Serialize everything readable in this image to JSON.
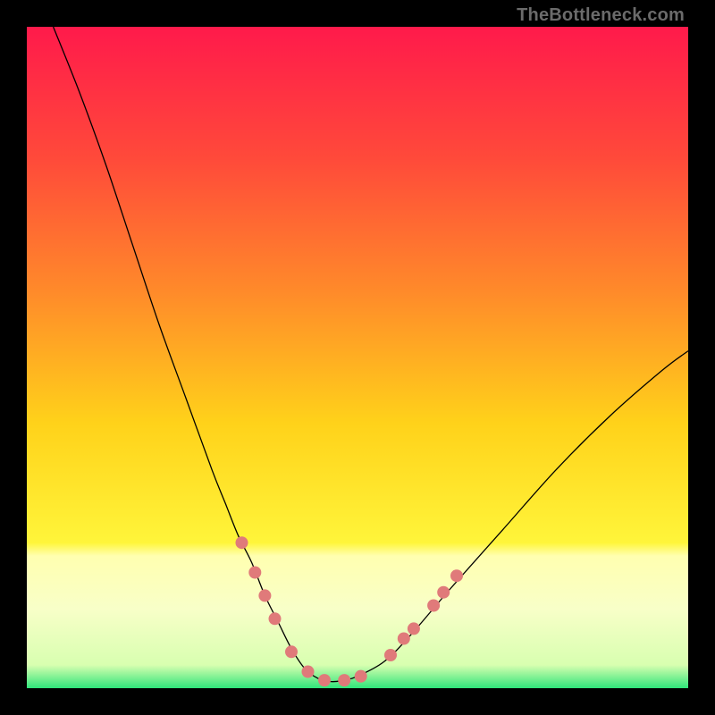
{
  "watermark": "TheBottleneck.com",
  "chart_data": {
    "type": "line",
    "title": "",
    "xlabel": "",
    "ylabel": "",
    "xlim": [
      0,
      100
    ],
    "ylim": [
      0,
      100
    ],
    "grid": false,
    "legend": false,
    "background_gradient": {
      "stops": [
        {
          "pos": 0.0,
          "color": "#ff1a4b"
        },
        {
          "pos": 0.2,
          "color": "#ff4a3a"
        },
        {
          "pos": 0.4,
          "color": "#ff8a2a"
        },
        {
          "pos": 0.6,
          "color": "#ffd21a"
        },
        {
          "pos": 0.78,
          "color": "#fff53a"
        },
        {
          "pos": 0.8,
          "color": "#ffffb0"
        },
        {
          "pos": 0.88,
          "color": "#f8ffc8"
        },
        {
          "pos": 0.965,
          "color": "#d8ffb0"
        },
        {
          "pos": 1.0,
          "color": "#2fe57a"
        }
      ]
    },
    "series": [
      {
        "name": "bottleneck-curve",
        "stroke": "#000000",
        "stroke_width": 1.3,
        "x": [
          4,
          8,
          12,
          16,
          20,
          24,
          28,
          30,
          32,
          34,
          36,
          38,
          40,
          42,
          44,
          46,
          48,
          50,
          54,
          58,
          64,
          72,
          80,
          88,
          96,
          100
        ],
        "y": [
          100,
          90,
          79,
          67,
          55,
          44,
          33,
          28,
          23,
          19,
          14,
          10,
          6,
          3,
          1.5,
          1,
          1.2,
          1.8,
          4,
          8,
          15,
          24,
          33,
          41,
          48,
          51
        ]
      }
    ],
    "markers": {
      "name": "highlight-dots",
      "color": "#e07a7a",
      "radius": 7,
      "points": [
        {
          "x": 32.5,
          "y": 22
        },
        {
          "x": 34.5,
          "y": 17.5
        },
        {
          "x": 36.0,
          "y": 14
        },
        {
          "x": 37.5,
          "y": 10.5
        },
        {
          "x": 40.0,
          "y": 5.5
        },
        {
          "x": 42.5,
          "y": 2.5
        },
        {
          "x": 45.0,
          "y": 1.2
        },
        {
          "x": 48.0,
          "y": 1.2
        },
        {
          "x": 50.5,
          "y": 1.8
        },
        {
          "x": 55.0,
          "y": 5.0
        },
        {
          "x": 57.0,
          "y": 7.5
        },
        {
          "x": 58.5,
          "y": 9.0
        },
        {
          "x": 61.5,
          "y": 12.5
        },
        {
          "x": 63.0,
          "y": 14.5
        },
        {
          "x": 65.0,
          "y": 17.0
        }
      ]
    }
  }
}
